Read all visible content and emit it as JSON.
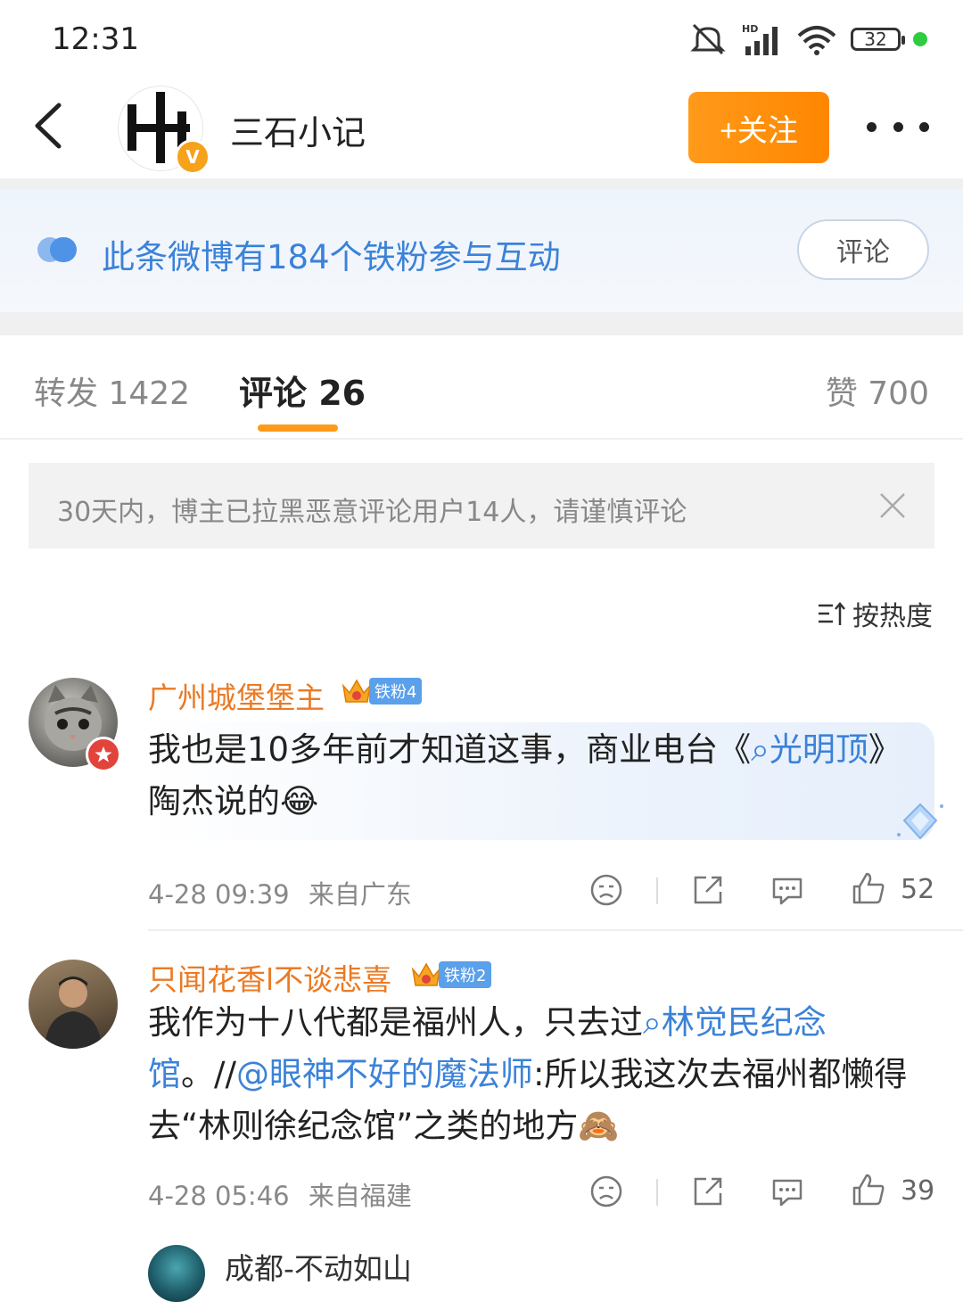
{
  "status": {
    "time": "12:31",
    "battery": "32"
  },
  "header": {
    "title": "三石小记",
    "follow_label": "+关注"
  },
  "fans_banner": {
    "text": "此条微博有184个铁粉参与互动",
    "button": "评论"
  },
  "tabs": {
    "repost": "转发 1422",
    "comment": "评论 26",
    "like": "赞 700"
  },
  "notice": {
    "text": "30天内，博主已拉黑恶意评论用户14人，请谨慎评论"
  },
  "sort": {
    "label": "按热度"
  },
  "comments": [
    {
      "name": "广州城堡堡主",
      "fan_badge": "铁粉4",
      "body_pre": "我也是10多年前才知道这事，商业电台《",
      "body_link": "光明顶",
      "body_post": "》陶杰说的",
      "time": "4-28 09:39",
      "location": "来自广东",
      "likes": "52"
    },
    {
      "name": "只闻花香l不谈悲喜",
      "fan_badge": "铁粉2",
      "body_pre": "我作为十八代都是福州人，只去过",
      "body_link": "林觉民纪念馆",
      "body_mid": "。//",
      "body_mention": "@眼神不好的魔法师",
      "body_post": ":所以我这次去福州都懒得去“林则徐纪念馆”之类的地方",
      "time": "4-28 05:46",
      "location": "来自福建",
      "likes": "39"
    },
    {
      "name": "成都-不动如山"
    }
  ]
}
